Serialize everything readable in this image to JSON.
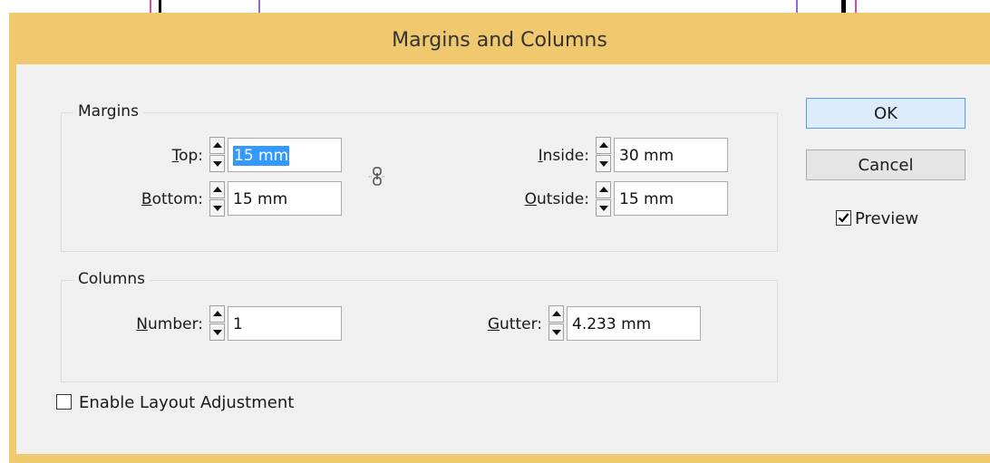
{
  "window": {
    "title": "Margins and Columns"
  },
  "margins": {
    "group_label": "Margins",
    "top": {
      "mnemonic": "T",
      "label_rest": "op:",
      "value": "15 mm"
    },
    "bottom": {
      "mnemonic": "B",
      "label_rest": "ottom:",
      "value": "15 mm"
    },
    "inside": {
      "mnemonic": "I",
      "label_rest": "nside:",
      "value": "30 mm"
    },
    "outside": {
      "mnemonic": "O",
      "label_rest": "utside:",
      "value": "15 mm"
    },
    "link_icon": "chain-link-icon"
  },
  "columns": {
    "group_label": "Columns",
    "number": {
      "mnemonic": "N",
      "label_rest": "umber:",
      "value": "1"
    },
    "gutter": {
      "mnemonic": "G",
      "label_rest": "utter:",
      "value": "4.233 mm"
    }
  },
  "buttons": {
    "ok": "OK",
    "cancel": "Cancel"
  },
  "preview": {
    "label": "Preview",
    "checked": true
  },
  "layout_adjustment": {
    "label": "Enable Layout Adjustment",
    "checked": false
  },
  "colors": {
    "titlebar": "#f0c96e",
    "client": "#f0f0f0",
    "selection": "#3399ff",
    "default_button_border": "#569de5"
  }
}
